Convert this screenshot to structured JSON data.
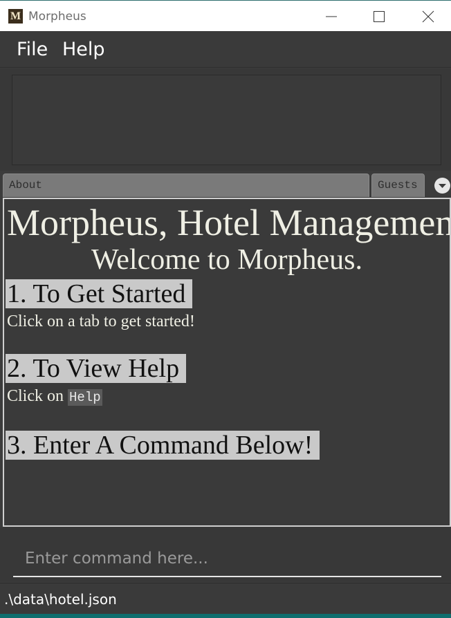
{
  "window": {
    "title": "Morpheus",
    "icon_letter": "M"
  },
  "menu": {
    "items": [
      {
        "label": "File"
      },
      {
        "label": "Help"
      }
    ]
  },
  "tabs": [
    {
      "label": "About",
      "selected": true
    },
    {
      "label": "Guests",
      "selected": false
    }
  ],
  "about": {
    "heading": "Morpheus, Hotel Management System",
    "welcome": "Welcome to Morpheus.",
    "sections": [
      {
        "title": "1. To Get Started",
        "text": "Click on a tab to get started!"
      },
      {
        "title": "2. To View Help",
        "text_prefix": "Click on",
        "code": "Help"
      },
      {
        "title": "3. Enter A Command Below!"
      }
    ]
  },
  "command": {
    "placeholder": "Enter command here...",
    "value": ""
  },
  "status": {
    "file_path": ".\\data\\hotel.json"
  },
  "colors": {
    "background": "#3c3c3c",
    "section_highlight": "#c9c9c9",
    "text_light": "#efefe4",
    "tab_inactive": "#7a7a7a"
  },
  "icons": {
    "app": "app-logo-icon",
    "minimize": "minimize-icon",
    "maximize": "maximize-icon",
    "close": "close-icon",
    "tab_overflow": "chevron-down-icon"
  }
}
